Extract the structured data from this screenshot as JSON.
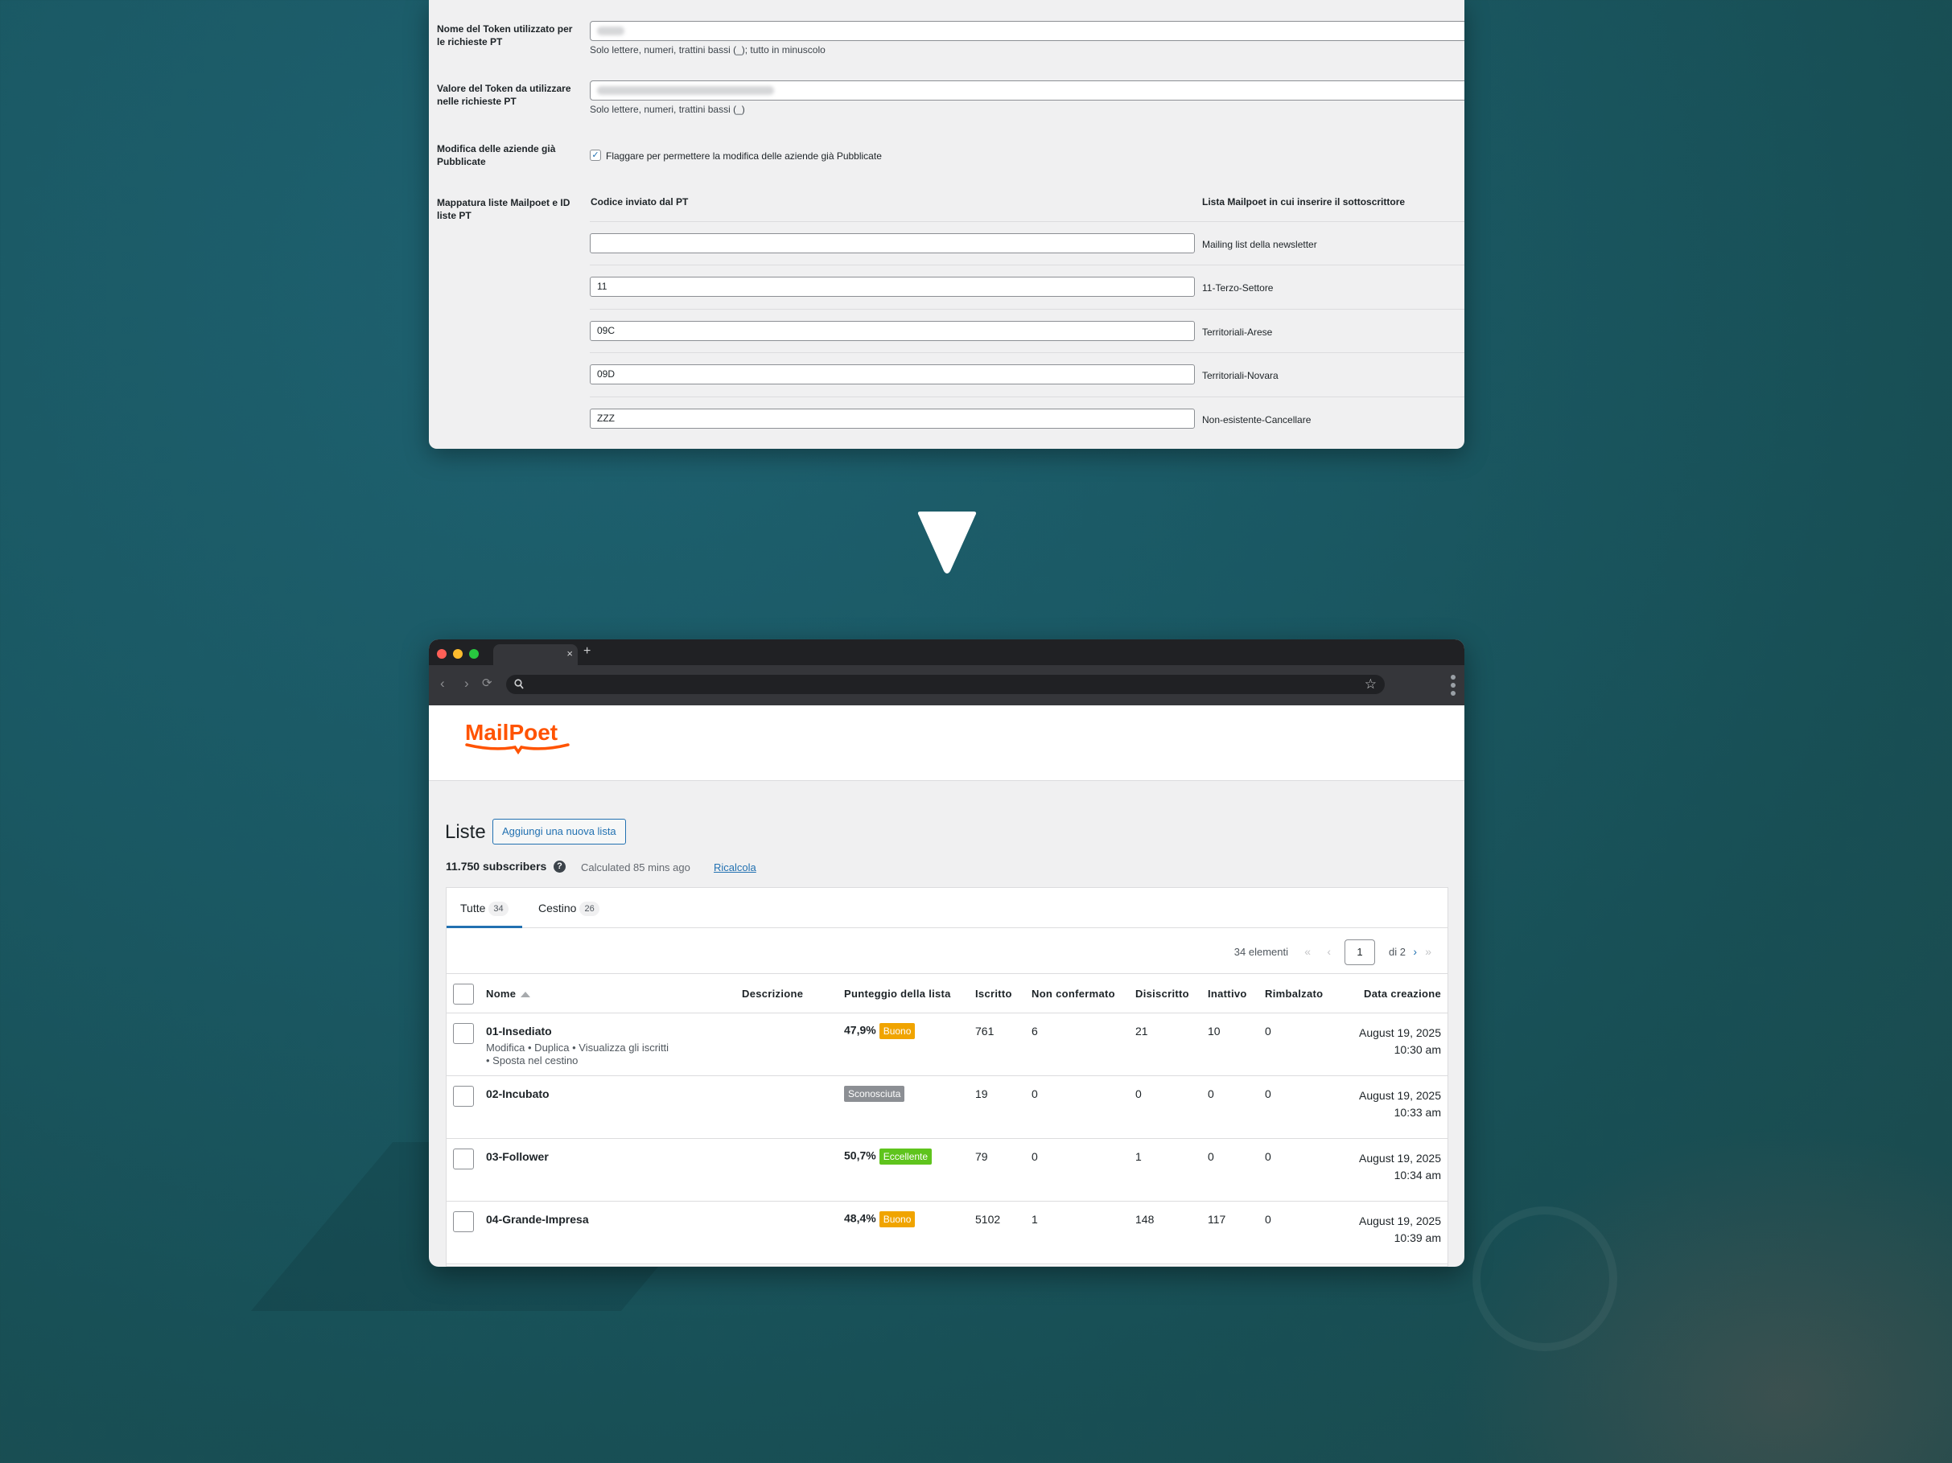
{
  "settings": {
    "token_name": {
      "label_line1": "Nome del Token utilizzato per",
      "label_line2": "le richieste PT",
      "help": "Solo lettere, numeri, trattini bassi (_); tutto in minuscolo"
    },
    "token_value": {
      "label_line1": "Valore del Token da utilizzare",
      "label_line2": "nelle richieste PT",
      "help": "Solo lettere, numeri, trattini bassi (_)"
    },
    "modify_companies": {
      "label_line1": "Modifica delle aziende già",
      "label_line2": "Pubblicate",
      "checkbox_label": "Flaggare per permettere la modifica delle aziende già Pubblicate",
      "checked": true
    },
    "mapping": {
      "label_line1": "Mappatura liste Mailpoet e ID",
      "label_line2": "liste PT",
      "col_code": "Codice inviato dal PT",
      "col_list": "Lista Mailpoet in cui inserire il sottoscrittore",
      "rows": [
        {
          "code": "",
          "list": "Mailing list della newsletter"
        },
        {
          "code": "11",
          "list": "11-Terzo-Settore"
        },
        {
          "code": "09C",
          "list": "Territoriali-Arese"
        },
        {
          "code": "09D",
          "list": "Territoriali-Novara"
        },
        {
          "code": "ZZZ",
          "list": "Non-esistente-Cancellare"
        }
      ]
    }
  },
  "browser": {
    "tab_close": "×",
    "new_tab": "+",
    "back": "‹",
    "forward": "›",
    "reload": "⟳",
    "star": "☆"
  },
  "mailpoet": {
    "logo_text": "MailPoet",
    "page_title": "Liste",
    "add_button": "Aggiungi una nuova lista",
    "subscribers": "11.750 subscribers",
    "help": "?",
    "calculated": "Calculated 85 mins ago",
    "recalc": "Ricalcola",
    "tabs": [
      {
        "label": "Tutte",
        "count": "34"
      },
      {
        "label": "Cestino",
        "count": "26"
      }
    ],
    "pagination": {
      "count": "34 elementi",
      "first": "«",
      "prev": "‹",
      "page": "1",
      "of": "di 2",
      "next": "›",
      "last": "»"
    },
    "columns": {
      "name": "Nome",
      "description": "Descrizione",
      "score": "Punteggio della lista",
      "subscribed": "Iscritto",
      "unconfirmed": "Non confermato",
      "unsubscribed": "Disiscritto",
      "inactive": "Inattivo",
      "bounced": "Rimbalzato",
      "created": "Data creazione"
    },
    "row_actions_line1": "Modifica • Duplica • Visualizza gli iscritti",
    "row_actions_line2": "• Sposta nel cestino",
    "rows": [
      {
        "name": "01-Insediato",
        "score": "47,9%",
        "badge": "Buono",
        "subscribed": "761",
        "unconfirmed": "6",
        "unsubscribed": "21",
        "inactive": "10",
        "bounced": "0",
        "date": "August 19, 2025",
        "time": "10:30 am"
      },
      {
        "name": "02-Incubato",
        "score": "",
        "badge": "Sconosciuta",
        "subscribed": "19",
        "unconfirmed": "0",
        "unsubscribed": "0",
        "inactive": "0",
        "bounced": "0",
        "date": "August 19, 2025",
        "time": "10:33 am"
      },
      {
        "name": "03-Follower",
        "score": "50,7%",
        "badge": "Eccellente",
        "subscribed": "79",
        "unconfirmed": "0",
        "unsubscribed": "1",
        "inactive": "0",
        "bounced": "0",
        "date": "August 19, 2025",
        "time": "10:34 am"
      },
      {
        "name": "04-Grande-Impresa",
        "score": "48,4%",
        "badge": "Buono",
        "subscribed": "5102",
        "unconfirmed": "1",
        "unsubscribed": "148",
        "inactive": "117",
        "bounced": "0",
        "date": "August 19, 2025",
        "time": "10:39 am"
      }
    ],
    "badge_colors": {
      "Buono": "#f0a400",
      "Sconosciuta": "#8c8f94",
      "Eccellente": "#5fc41d"
    }
  },
  "colors": {
    "accent": "#2271b1",
    "logo_orange": "#ff5301",
    "background": "#1a5863"
  }
}
